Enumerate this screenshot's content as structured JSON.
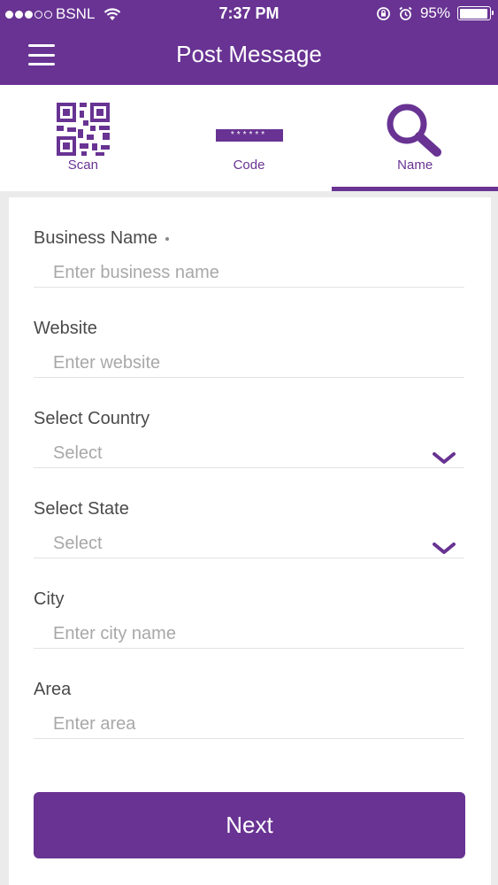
{
  "status_bar": {
    "carrier": "BSNL",
    "time": "7:37 PM",
    "battery": "95%",
    "battery_level": 0.95
  },
  "header": {
    "title": "Post Message"
  },
  "tabs": [
    {
      "label": "Scan",
      "icon": "qr-code-icon",
      "active": false
    },
    {
      "label": "Code",
      "icon": "code-stars-icon",
      "active": false,
      "code_mask": "******"
    },
    {
      "label": "Name",
      "icon": "search-icon",
      "active": true
    }
  ],
  "form": {
    "business_name": {
      "label": "Business Name",
      "placeholder": "Enter business name",
      "required": true
    },
    "website": {
      "label": "Website",
      "placeholder": "Enter website"
    },
    "country": {
      "label": "Select Country",
      "value": "Select"
    },
    "state": {
      "label": "Select State",
      "value": "Select"
    },
    "city": {
      "label": "City",
      "placeholder": "Enter city name"
    },
    "area": {
      "label": "Area",
      "placeholder": "Enter area"
    }
  },
  "next_button": {
    "label": "Next"
  },
  "colors": {
    "brand": "#683393",
    "placeholder": "#a8a8a8",
    "label": "#4a4a4a",
    "background": "#ebebeb"
  }
}
